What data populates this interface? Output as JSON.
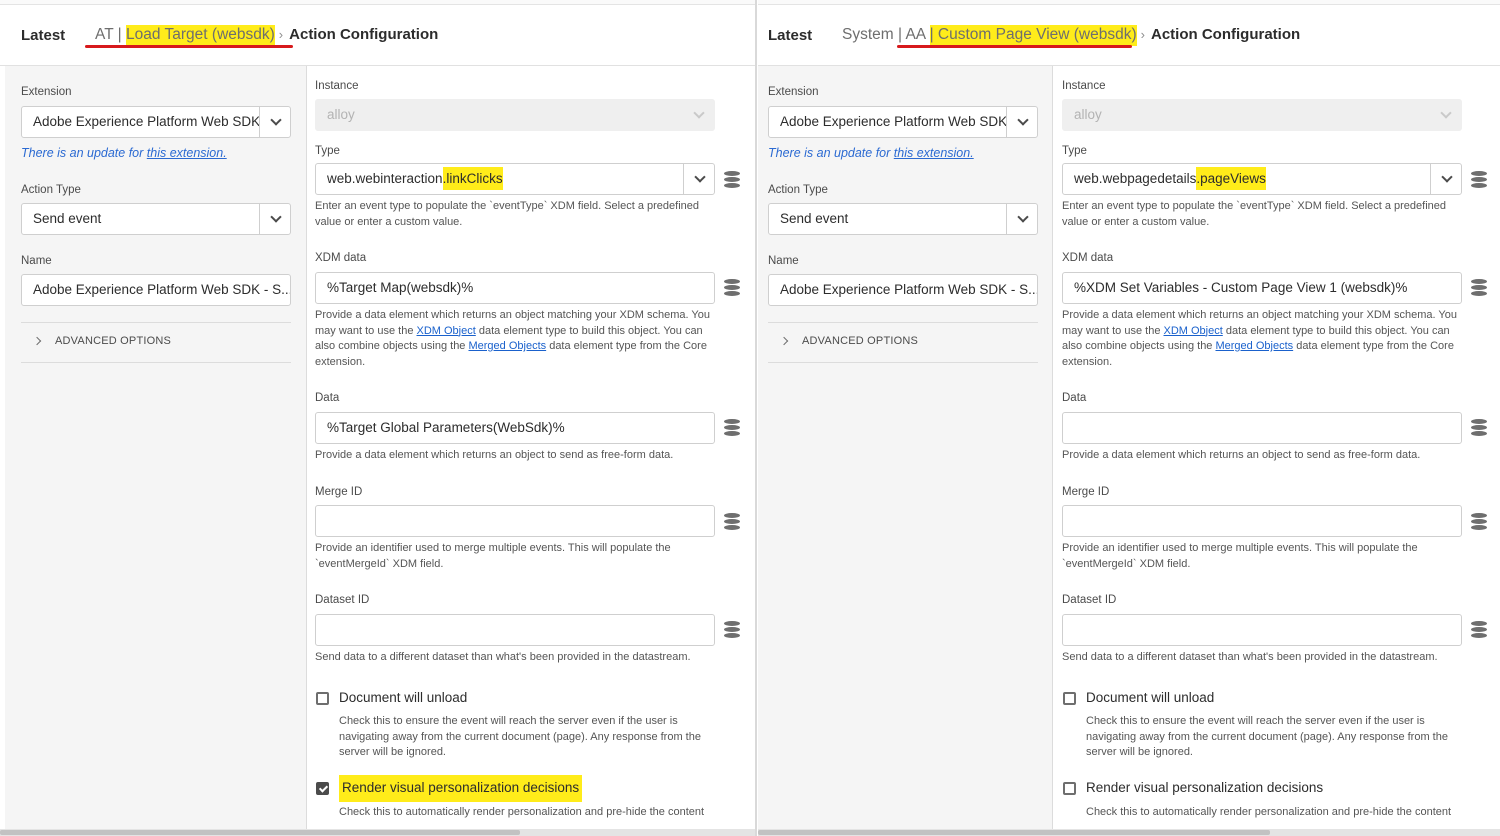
{
  "left_pane": {
    "header": {
      "latest": "Latest",
      "crumb_prefix": "AT | ",
      "crumb_rule": "Load Target (websdk)",
      "crumb_current": "Action Configuration"
    },
    "extension_label": "Extension",
    "extension_value": "Adobe Experience Platform Web SDK",
    "update_text": "There is an update for ",
    "update_link": "this extension.",
    "action_type_label": "Action Type",
    "action_type_value": "Send event",
    "name_label": "Name",
    "name_value": "Adobe Experience Platform Web SDK - S...",
    "advanced_options": "ADVANCED OPTIONS",
    "instance_label": "Instance",
    "instance_value": "alloy",
    "type_label": "Type",
    "type_value_prefix": "web.webinteraction",
    "type_value_highlight": ".linkClicks",
    "type_help": "Enter an event type to populate the `eventType` XDM field. Select a predefined value or enter a custom value.",
    "xdm_label": "XDM data",
    "xdm_value": "%Target Map(websdk)%",
    "xdm_help_1": "Provide a data element which returns an object matching your XDM schema. You may want to use the ",
    "xdm_help_link1": "XDM Object",
    "xdm_help_2": " data element type to build this object. You can also combine objects using the ",
    "xdm_help_link2": "Merged Objects",
    "xdm_help_3": " data element type from the Core extension.",
    "data_label": "Data",
    "data_value": "%Target Global Parameters(WebSdk)%",
    "data_help": "Provide a data element which returns an object to send as free-form data.",
    "merge_label": "Merge ID",
    "merge_value": "",
    "merge_help": "Provide an identifier used to merge multiple events. This will populate the `eventMergeId` XDM field.",
    "dataset_label": "Dataset ID",
    "dataset_value": "",
    "dataset_help": "Send data to a different dataset than what's been provided in the datastream.",
    "doc_unload_label": "Document will unload",
    "doc_unload_checked": false,
    "doc_unload_help": "Check this to ensure the event will reach the server even if the user is navigating away from the current document (page). Any response from the server will be ignored.",
    "render_label": "Render visual personalization decisions",
    "render_checked": true,
    "render_help": "Check this to automatically render personalization and pre-hide the content"
  },
  "right_pane": {
    "header": {
      "latest": "Latest",
      "crumb_prefix": "System | AA ",
      "crumb_rule": "| Custom Page View (websdk)",
      "crumb_current": "Action Configuration"
    },
    "extension_label": "Extension",
    "extension_value": "Adobe Experience Platform Web SDK",
    "update_text": "There is an update for ",
    "update_link": "this extension.",
    "action_type_label": "Action Type",
    "action_type_value": "Send event",
    "name_label": "Name",
    "name_value": "Adobe Experience Platform Web SDK - S...",
    "advanced_options": "ADVANCED OPTIONS",
    "instance_label": "Instance",
    "instance_value": "alloy",
    "type_label": "Type",
    "type_value_prefix": "web.webpagedetails",
    "type_value_highlight": ".pageViews",
    "type_help": "Enter an event type to populate the `eventType` XDM field. Select a predefined value or enter a custom value.",
    "xdm_label": "XDM data",
    "xdm_value": "%XDM Set Variables - Custom Page View 1 (websdk)%",
    "xdm_help_1": "Provide a data element which returns an object matching your XDM schema. You may want to use the ",
    "xdm_help_link1": "XDM Object",
    "xdm_help_2": " data element type to build this object. You can also combine objects using the ",
    "xdm_help_link2": "Merged Objects",
    "xdm_help_3": " data element type from the Core extension.",
    "data_label": "Data",
    "data_value": "",
    "data_help": "Provide a data element which returns an object to send as free-form data.",
    "merge_label": "Merge ID",
    "merge_value": "",
    "merge_help": "Provide an identifier used to merge multiple events. This will populate the `eventMergeId` XDM field.",
    "dataset_label": "Dataset ID",
    "dataset_value": "",
    "dataset_help": "Send data to a different dataset than what's been provided in the datastream.",
    "doc_unload_label": "Document will unload",
    "doc_unload_checked": false,
    "doc_unload_help": "Check this to ensure the event will reach the server even if the user is navigating away from the current document (page). Any response from the server will be ignored.",
    "render_label": "Render visual personalization decisions",
    "render_checked": false,
    "render_help": "Check this to automatically render personalization and pre-hide the content"
  },
  "colors": {
    "highlight": "#ffec1a",
    "underline": "#d7191c",
    "link": "#1a61cc",
    "update_link": "#2b6ad2"
  },
  "icons": {
    "data_element_picker": "database-icon",
    "dropdown": "chevron-down-icon",
    "breadcrumb_separator": "chevron-right-icon",
    "advanced_toggle": "chevron-right-icon"
  }
}
